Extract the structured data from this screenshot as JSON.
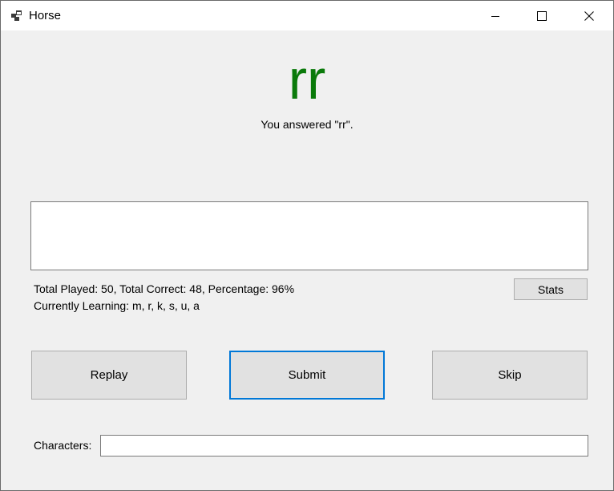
{
  "window": {
    "title": "Horse"
  },
  "quiz": {
    "big_text": "rr",
    "answered_text": "You answered \"rr\".",
    "big_text_color": "#0a7a0a",
    "output_text": ""
  },
  "stats": {
    "totals_line": "Total Played: 50, Total Correct: 48, Percentage: 96%",
    "learning_line": "Currently Learning: m, r, k, s, u, a",
    "stats_button_label": "Stats"
  },
  "actions": {
    "replay_label": "Replay",
    "submit_label": "Submit",
    "skip_label": "Skip"
  },
  "characters": {
    "label": "Characters:",
    "value": ""
  },
  "icons": {
    "app": "app-window-icon",
    "minimize": "minimize-icon",
    "maximize": "maximize-icon",
    "close": "close-icon"
  }
}
